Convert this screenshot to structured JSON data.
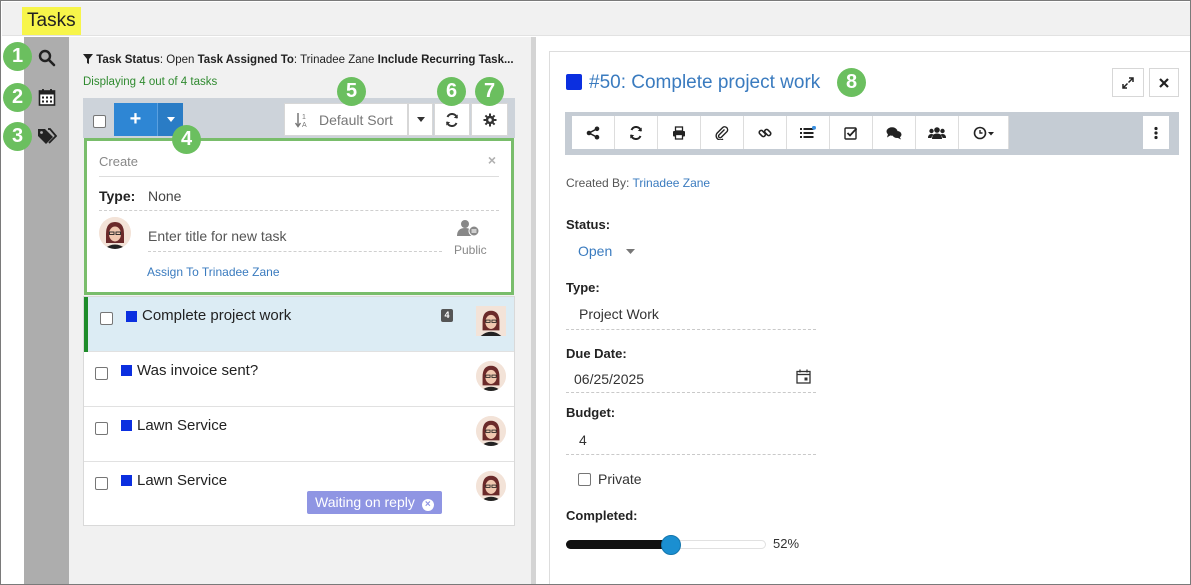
{
  "app": {
    "title": "Tasks"
  },
  "callouts": [
    "1",
    "2",
    "3",
    "4",
    "5",
    "6",
    "7",
    "8"
  ],
  "left_icons": [
    "search-icon",
    "calendar-icon",
    "tags-icon"
  ],
  "filter": {
    "label1": "Task Status",
    "value1": ": Open ",
    "label2": "Task Assigned To",
    "value2": ": Trinadee Zane ",
    "label3": "Include Recurring Task..."
  },
  "display_count": "Displaying 4 out of 4 tasks",
  "toolbar": {
    "new_icon": "+",
    "sort_label": "Default Sort"
  },
  "create": {
    "title": "Create",
    "close": "×",
    "type_label": "Type:",
    "type_value": "None",
    "title_placeholder": "Enter title for new task",
    "visibility": "Public",
    "assign_link": "Assign To Trinadee Zane"
  },
  "tasks": [
    {
      "title": "Complete project work",
      "badge": "4",
      "color": "#0b2fe0",
      "selected": true
    },
    {
      "title": "Was invoice sent?",
      "color": "#0b2fe0"
    },
    {
      "title": "Lawn Service",
      "color": "#0b2fe0"
    },
    {
      "title": "Lawn Service",
      "color": "#0b2fe0",
      "tag": "Waiting on reply"
    }
  ],
  "detail": {
    "title": "#50: Complete project work",
    "created_by_label": "Created By:",
    "created_by": "Trinadee Zane",
    "status_label": "Status:",
    "status_value": "Open",
    "type_label": "Type:",
    "type_value": "Project Work",
    "due_label": "Due Date:",
    "due_value": "06/25/2025",
    "budget_label": "Budget:",
    "budget_value": "4",
    "private_label": "Private",
    "completed_label": "Completed:",
    "completed_value": "52%",
    "completed_fraction": 0.52
  },
  "detail_toolbar_icons": [
    "share-icon",
    "refresh-icon",
    "print-icon",
    "attachment-icon",
    "link-icon",
    "checklist-icon",
    "checkbox-icon",
    "comments-icon",
    "users-icon",
    "clock-icon",
    "more-icon"
  ],
  "colors": {
    "accent": "#2e86d4",
    "link": "#3a7bbf",
    "highlight": "#f7f54a",
    "callout": "#6bbf5f",
    "task_color": "#0b2fe0",
    "tag": "#8f95e3"
  }
}
